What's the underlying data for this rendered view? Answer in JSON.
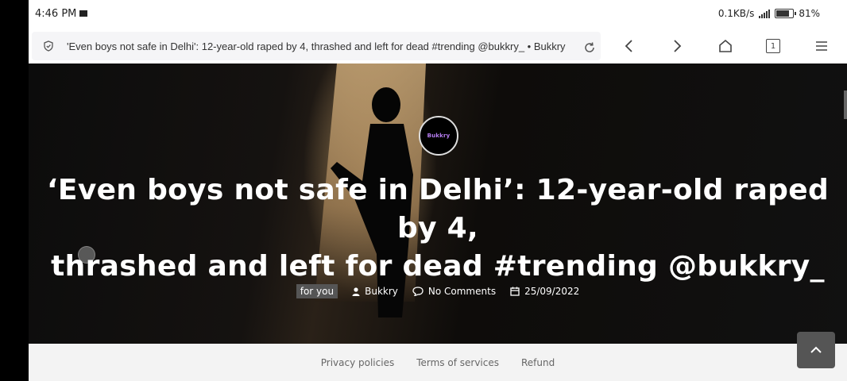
{
  "status_bar": {
    "time": "4:46 PM",
    "network_speed": "0.1KB/s",
    "battery": "81%"
  },
  "browser": {
    "url_title": "'Even boys not safe in Delhi': 12-year-old raped by 4, thrashed and left for dead #trending @bukkry_ • Bukkry",
    "tab_count": "1"
  },
  "article": {
    "logo_text": "Bukkry",
    "title_line1": "‘Even boys not safe in Delhi’: 12-year-old raped by 4,",
    "title_line2": "thrashed and left for dead #trending @bukkry_",
    "category": "for you",
    "author": "Bukkry",
    "comments": "No Comments",
    "date": "25/09/2022"
  },
  "footer": {
    "links": [
      "Privacy policies",
      "Terms of services",
      "Refund"
    ]
  },
  "colors": {
    "accent": "#b57cf0",
    "footer_bg": "#f3f3f3"
  }
}
